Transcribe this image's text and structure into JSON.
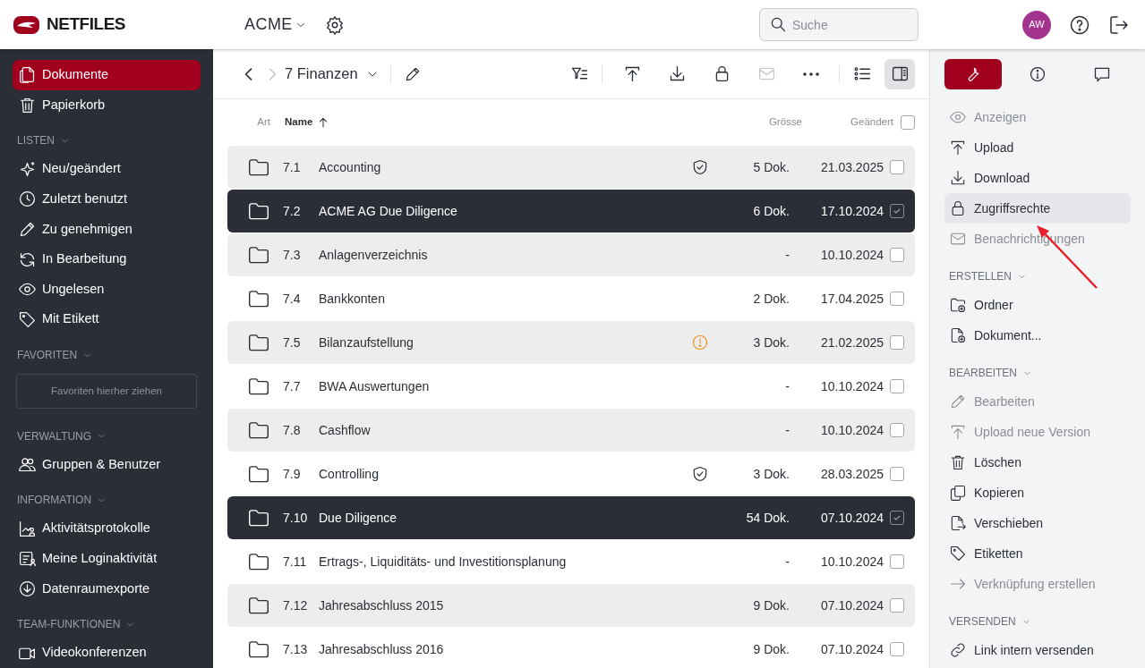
{
  "header": {
    "logo": "NETFILES",
    "workspace": "ACME",
    "search": {
      "placeholder": "Suche"
    },
    "avatar": "AW"
  },
  "sidebar": {
    "sections": [
      {
        "items": [
          {
            "label": "Dokumente",
            "selected": true
          },
          {
            "label": "Papierkorb",
            "selected": false
          }
        ]
      },
      {
        "title": "LISTEN",
        "items": [
          {
            "label": "Neu/geändert",
            "selected": false
          },
          {
            "label": "Zuletzt benutzt",
            "selected": false
          },
          {
            "label": "Zu genehmigen",
            "selected": false
          },
          {
            "label": "In Bearbeitung",
            "selected": false
          },
          {
            "label": "Ungelesen",
            "selected": false
          },
          {
            "label": "Mit Etikett",
            "selected": false
          }
        ]
      },
      {
        "title": "FAVORITEN",
        "dropzone": "Favoriten hierher ziehen"
      },
      {
        "title": "VERWALTUNG",
        "items": [
          {
            "label": "Gruppen & Benutzer",
            "selected": false
          }
        ]
      },
      {
        "title": "INFORMATION",
        "items": [
          {
            "label": "Aktivitätsprotokolle",
            "selected": false
          },
          {
            "label": "Meine Loginaktivität",
            "selected": false
          },
          {
            "label": "Datenraumexporte",
            "selected": false
          }
        ]
      },
      {
        "title": "TEAM-FUNKTIONEN",
        "items": [
          {
            "label": "Videokonferenzen",
            "selected": false
          }
        ]
      }
    ]
  },
  "breadcrumb": {
    "folder": "7 Finanzen"
  },
  "toolbar": {
    "actions": [
      {
        "disabled": false
      },
      {
        "disabled": false
      },
      {
        "disabled": false
      },
      {
        "disabled": false
      },
      {
        "disabled": true
      },
      {
        "disabled": false
      }
    ],
    "details_panel_on": true
  },
  "table": {
    "columns": [
      "Art",
      "Name",
      "Grösse",
      "Geändert"
    ],
    "sorted_ascending": true,
    "all_checked": false,
    "rows": [
      {
        "number": "7.1",
        "name": "Accounting",
        "protected": true,
        "warning": false,
        "size": "5 Dok.",
        "modified": "21.03.2025",
        "selected": false
      },
      {
        "number": "7.2",
        "name": "ACME AG Due Diligence",
        "size": "6 Dok.",
        "modified": "17.10.2024",
        "selected": true
      },
      {
        "number": "7.3",
        "name": "Anlagenverzeichnis",
        "size": "-",
        "modified": "10.10.2024",
        "selected": false
      },
      {
        "number": "7.4",
        "name": "Bankkonten",
        "size": "2 Dok.",
        "modified": "17.04.2025",
        "selected": false
      },
      {
        "number": "7.5",
        "name": "Bilanzaufstellung",
        "protected": false,
        "warning": true,
        "size": "3 Dok.",
        "modified": "21.02.2025",
        "selected": false
      },
      {
        "number": "7.7",
        "name": "BWA Auswertungen",
        "size": "-",
        "modified": "10.10.2024",
        "selected": false
      },
      {
        "number": "7.8",
        "name": "Cashflow",
        "size": "-",
        "modified": "10.10.2024",
        "selected": false
      },
      {
        "number": "7.9",
        "name": "Controlling",
        "protected": true,
        "warning": false,
        "size": "3 Dok.",
        "modified": "28.03.2025",
        "selected": false
      },
      {
        "number": "7.10",
        "name": "Due Diligence",
        "size": "54 Dok.",
        "modified": "07.10.2024",
        "selected": true
      },
      {
        "number": "7.11",
        "name": "Ertrags-, Liquiditäts- und Investitionsplanung",
        "size": "-",
        "modified": "10.10.2024",
        "selected": false
      },
      {
        "number": "7.12",
        "name": "Jahresabschluss 2015",
        "size": "9 Dok.",
        "modified": "07.10.2024",
        "selected": false
      },
      {
        "number": "7.13",
        "name": "Jahresabschluss 2016",
        "size": "9 Dok.",
        "modified": "07.10.2024",
        "selected": false
      }
    ]
  },
  "panel": {
    "tabs": [
      {
        "selected": true
      },
      {
        "selected": false
      },
      {
        "selected": false
      }
    ],
    "sections": [
      {
        "items": [
          {
            "label": "Anzeigen",
            "disabled": true,
            "highlighted": false
          },
          {
            "label": "Upload",
            "disabled": false,
            "highlighted": false
          },
          {
            "label": "Download",
            "disabled": false,
            "highlighted": false
          },
          {
            "label": "Zugriffsrechte",
            "disabled": false,
            "highlighted": true
          },
          {
            "label": "Benachrichtigungen",
            "disabled": true,
            "highlighted": false
          }
        ]
      },
      {
        "title": "ERSTELLEN",
        "items": [
          {
            "label": "Ordner",
            "disabled": false,
            "highlighted": false
          },
          {
            "label": "Dokument...",
            "disabled": false,
            "highlighted": false
          }
        ]
      },
      {
        "title": "BEARBEITEN",
        "items": [
          {
            "label": "Bearbeiten",
            "disabled": true,
            "highlighted": false
          },
          {
            "label": "Upload neue Version",
            "disabled": true,
            "highlighted": false
          },
          {
            "label": "Löschen",
            "disabled": false,
            "highlighted": false
          },
          {
            "label": "Kopieren",
            "disabled": false,
            "highlighted": false
          },
          {
            "label": "Verschieben",
            "disabled": false,
            "highlighted": false
          },
          {
            "label": "Etiketten",
            "disabled": false,
            "highlighted": false
          },
          {
            "label": "Verknüpfung erstellen",
            "disabled": true,
            "highlighted": false
          }
        ]
      },
      {
        "title": "VERSENDEN",
        "items": [
          {
            "label": "Link intern versenden",
            "disabled": false,
            "highlighted": false
          }
        ]
      }
    ]
  }
}
